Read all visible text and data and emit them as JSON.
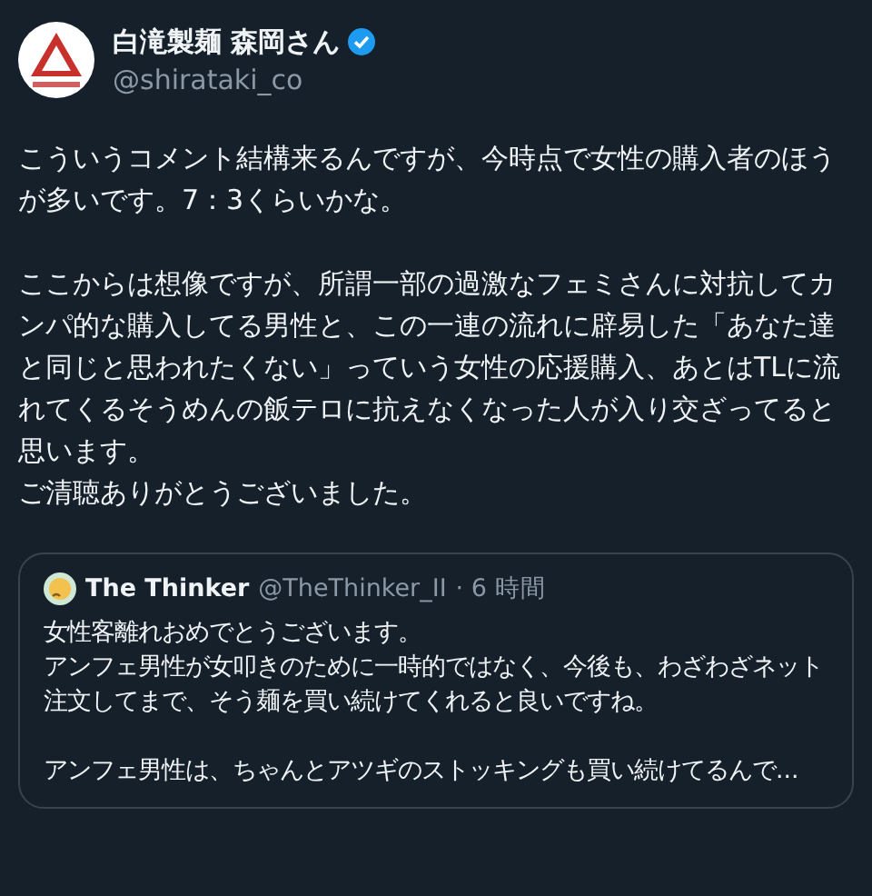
{
  "author": {
    "name": "白滝製麺 森岡さん",
    "verified": true,
    "handle": "@shirataki_co"
  },
  "post": {
    "paragraphs": [
      [
        "こういうコメント結構来るんですが、今時点で女性の購入者のほうが多いです。7：3くらいかな。"
      ],
      [
        "ここからは想像ですが、所謂一部の過激なフェミさんに対抗してカンパ的な購入してる男性と、この一連の流れに辟易した「あなた達と同じと思われたくない」っていう女性の応援購入、あとはTLに流れてくるそうめんの飯テロに抗えなくなった人が入り交ざってると思います。",
        "ご清聴ありがとうございました。"
      ]
    ]
  },
  "quote": {
    "name": "The Thinker",
    "handle": "@TheThinker_II",
    "time": "· 6 時間",
    "paragraphs": [
      [
        "女性客離れおめでとうございます。",
        "アンフェ男性が女叩きのために一時的ではなく、今後も、わざわざネット注文してまで、そう麺を買い続けてくれると良いですね。"
      ],
      [
        "アンフェ男性は、ちゃんとアツギのストッキングも買い続けてるんで..."
      ]
    ]
  }
}
